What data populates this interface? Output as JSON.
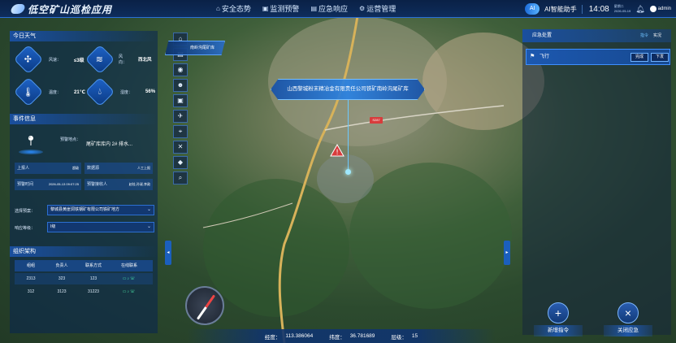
{
  "header": {
    "app_title": "低空矿山巡检应用",
    "nav": [
      {
        "label": "安全态势",
        "icon": "house-icon"
      },
      {
        "label": "监测预警",
        "icon": "monitor-icon"
      },
      {
        "label": "应急响应",
        "icon": "lock-icon"
      },
      {
        "label": "运营管理",
        "icon": "gear-icon"
      }
    ],
    "ai_assistant": "AI智能助手",
    "ai_badge": "AI",
    "time": "14:08",
    "weekday": "星期二",
    "date": "2026-05-19",
    "user": "admin"
  },
  "weather": {
    "title": "今日天气",
    "wind_speed_label": "风速：",
    "wind_speed_value": "≤3级",
    "wind_dir_label": "风向：",
    "wind_dir_value": "西北风",
    "temp_label": "温度：",
    "temp_value": "21℃",
    "humidity_label": "湿度：",
    "humidity_value": "56%"
  },
  "event": {
    "title": "事件信息",
    "location_label": "预警地点：",
    "location_value": "尾矿库库内 2# 排水...",
    "reporter_label": "上报人",
    "reporter_value": "超级",
    "source_label": "数据源",
    "source_value": "人工上报",
    "alert_time_label": "预警时间",
    "alert_time_value": "2026-05-13 09:07:25",
    "receiver_label": "预警接收人",
    "receiver_value": "赵桂,孙淑,李勋"
  },
  "plan": {
    "select_label": "选择预案：",
    "select_value": "黎城县黄崖洞铁钢矿有限公司铁矿地方",
    "level_label": "响应等级：",
    "level_value": "I级"
  },
  "org": {
    "title": "组织架构",
    "columns": [
      "组组",
      "负责人",
      "联系方式",
      "在线联系"
    ],
    "rows": [
      [
        "2313",
        "323",
        "123"
      ],
      [
        "312",
        "3123",
        "31223"
      ]
    ]
  },
  "map": {
    "location_banner": "山西黎城粉末精冶金有限责任公司铁矿南岭沟尾矿库",
    "small_popup": "南岭沟尾矿库",
    "road_tag": "S287",
    "longitude_label": "经度：",
    "longitude": "113.386064",
    "latitude_label": "纬度：",
    "latitude": "36.781689",
    "level_label": "层级：",
    "level": "15"
  },
  "toolbar": [
    "home-icon",
    "layers-icon",
    "camera-icon",
    "user-icon",
    "save-icon",
    "drone-icon",
    "measure-icon",
    "tools-icon",
    "cube-icon",
    "search-icon"
  ],
  "emergency": {
    "title": "应急处置",
    "tab_command": "指令",
    "tab_live": "实况",
    "task_label": "飞行",
    "done_btn": "完成",
    "issue_btn": "下发",
    "add_cmd": "新增指令",
    "close_emergency": "关闭应急"
  },
  "colors": {
    "accent": "#2c6fd1",
    "alert_red": "#d83c3c",
    "online_green": "#49e3a9"
  }
}
